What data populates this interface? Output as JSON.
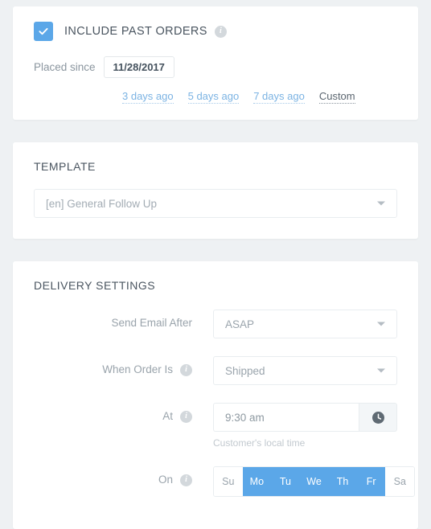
{
  "past_orders": {
    "checkbox_checked": true,
    "title": "INCLUDE PAST ORDERS",
    "info_glyph": "i",
    "placed_since_label": "Placed since",
    "date_value": "11/28/2017",
    "quick_links": [
      {
        "label": "3 days ago",
        "active": false
      },
      {
        "label": "5 days ago",
        "active": false
      },
      {
        "label": "7 days ago",
        "active": false
      },
      {
        "label": "Custom",
        "active": true
      }
    ]
  },
  "template": {
    "title": "TEMPLATE",
    "selected": "[en] General Follow Up"
  },
  "delivery": {
    "title": "DELIVERY SETTINGS",
    "send_email_after": {
      "label": "Send Email After",
      "value": "ASAP"
    },
    "when_order_is": {
      "label": "When Order Is",
      "value": "Shipped"
    },
    "at": {
      "label": "At",
      "value": "9:30 am",
      "helper": "Customer's local time",
      "button_icon": "clock-icon"
    },
    "on": {
      "label": "On",
      "days": [
        {
          "label": "Su",
          "selected": false
        },
        {
          "label": "Mo",
          "selected": true
        },
        {
          "label": "Tu",
          "selected": true
        },
        {
          "label": "We",
          "selected": true
        },
        {
          "label": "Th",
          "selected": true
        },
        {
          "label": "Fr",
          "selected": true
        },
        {
          "label": "Sa",
          "selected": false
        }
      ]
    }
  },
  "colors": {
    "accent": "#5ba7e8",
    "page_bg": "#eef1f3",
    "card_bg": "#ffffff",
    "label_gray": "#99a3ab"
  }
}
